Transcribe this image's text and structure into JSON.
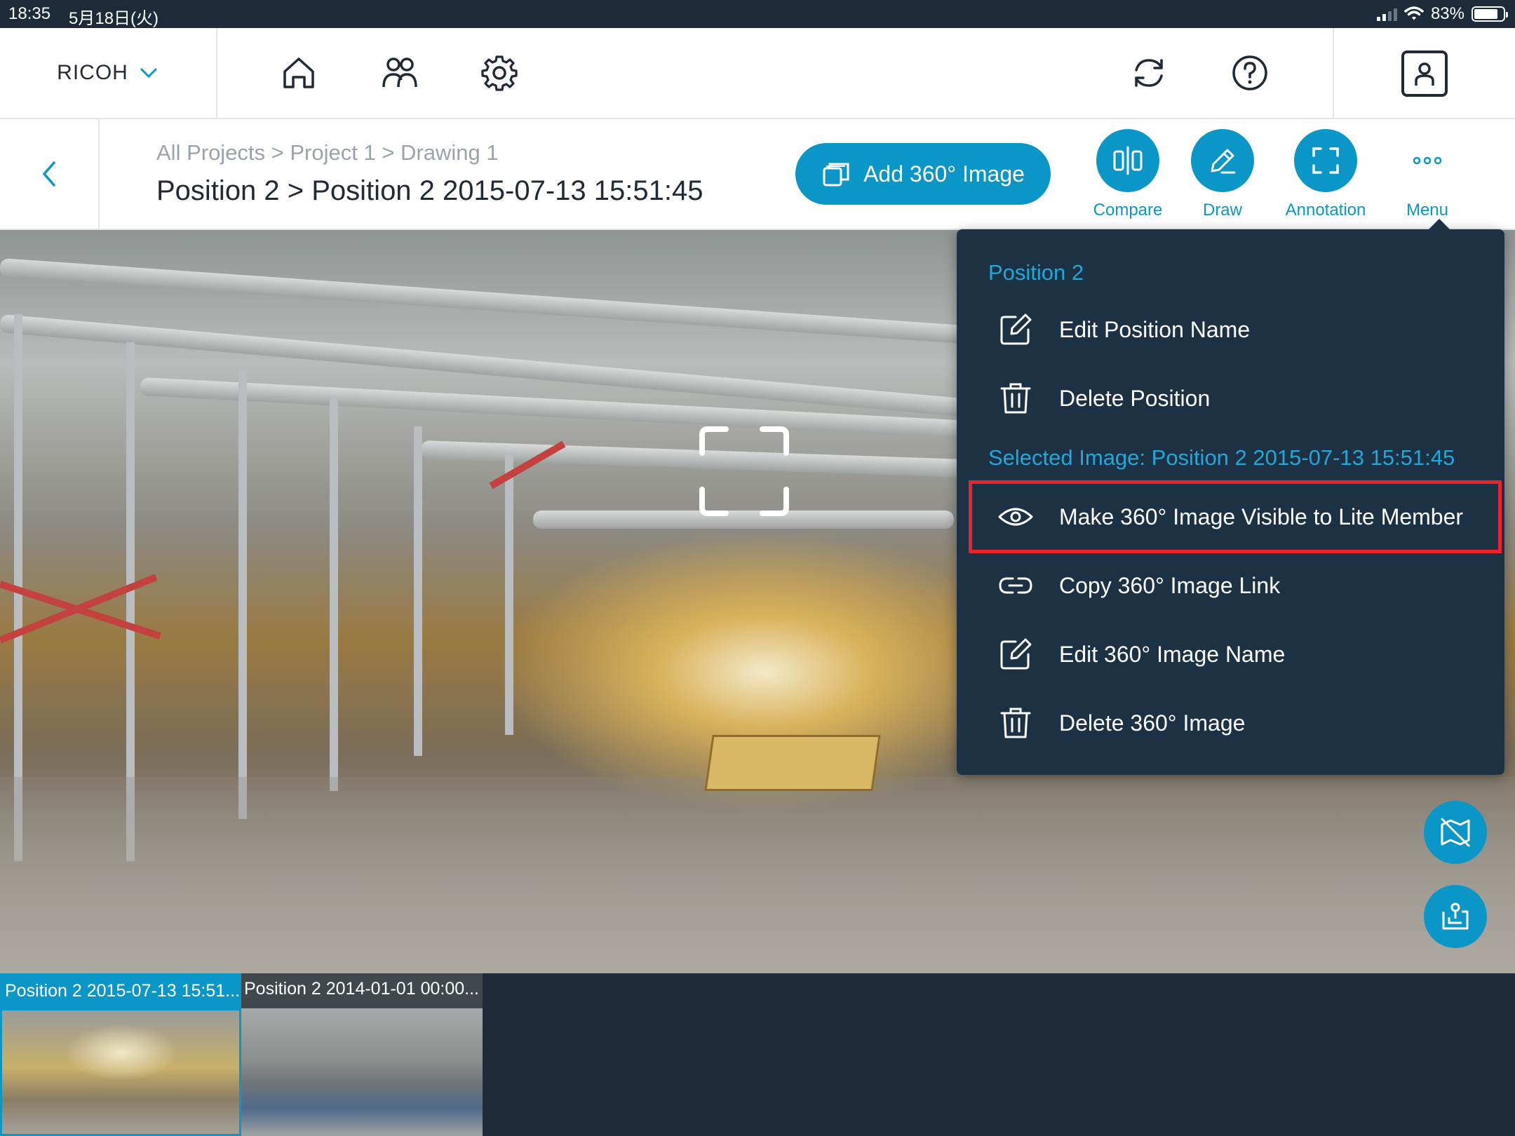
{
  "status_bar": {
    "time": "18:35",
    "date": "5月18日(火)",
    "battery": "83%"
  },
  "nav": {
    "brand": "RICOH"
  },
  "header": {
    "breadcrumb": "All Projects > Project 1 > Drawing 1",
    "title": "Position 2 > Position 2 2015-07-13 15:51:45",
    "add_button_label": "Add 360° Image",
    "tools": {
      "compare": "Compare",
      "draw": "Draw",
      "annotation": "Annotation",
      "menu": "Menu"
    }
  },
  "menu": {
    "position_section": "Position 2",
    "position_items": [
      {
        "label": "Edit Position Name",
        "icon": "edit-icon"
      },
      {
        "label": "Delete Position",
        "icon": "trash-icon"
      }
    ],
    "image_section": "Selected Image: Position 2 2015-07-13 15:51:45",
    "image_items": [
      {
        "label": "Make 360° Image Visible to Lite Member",
        "icon": "eye-icon",
        "highlighted": true
      },
      {
        "label": "Copy 360° Image Link",
        "icon": "link-icon"
      },
      {
        "label": "Edit 360° Image Name",
        "icon": "edit-icon"
      },
      {
        "label": "Delete 360° Image",
        "icon": "trash-icon"
      }
    ]
  },
  "filmstrip": [
    {
      "caption": "Position 2 2015-07-13 15:51...",
      "selected": true
    },
    {
      "caption": "Position 2 2014-01-01 00:00...",
      "selected": false
    }
  ],
  "colors": {
    "accent": "#0a96c6",
    "menu_bg": "#1d3145",
    "highlight": "#e8242c"
  }
}
